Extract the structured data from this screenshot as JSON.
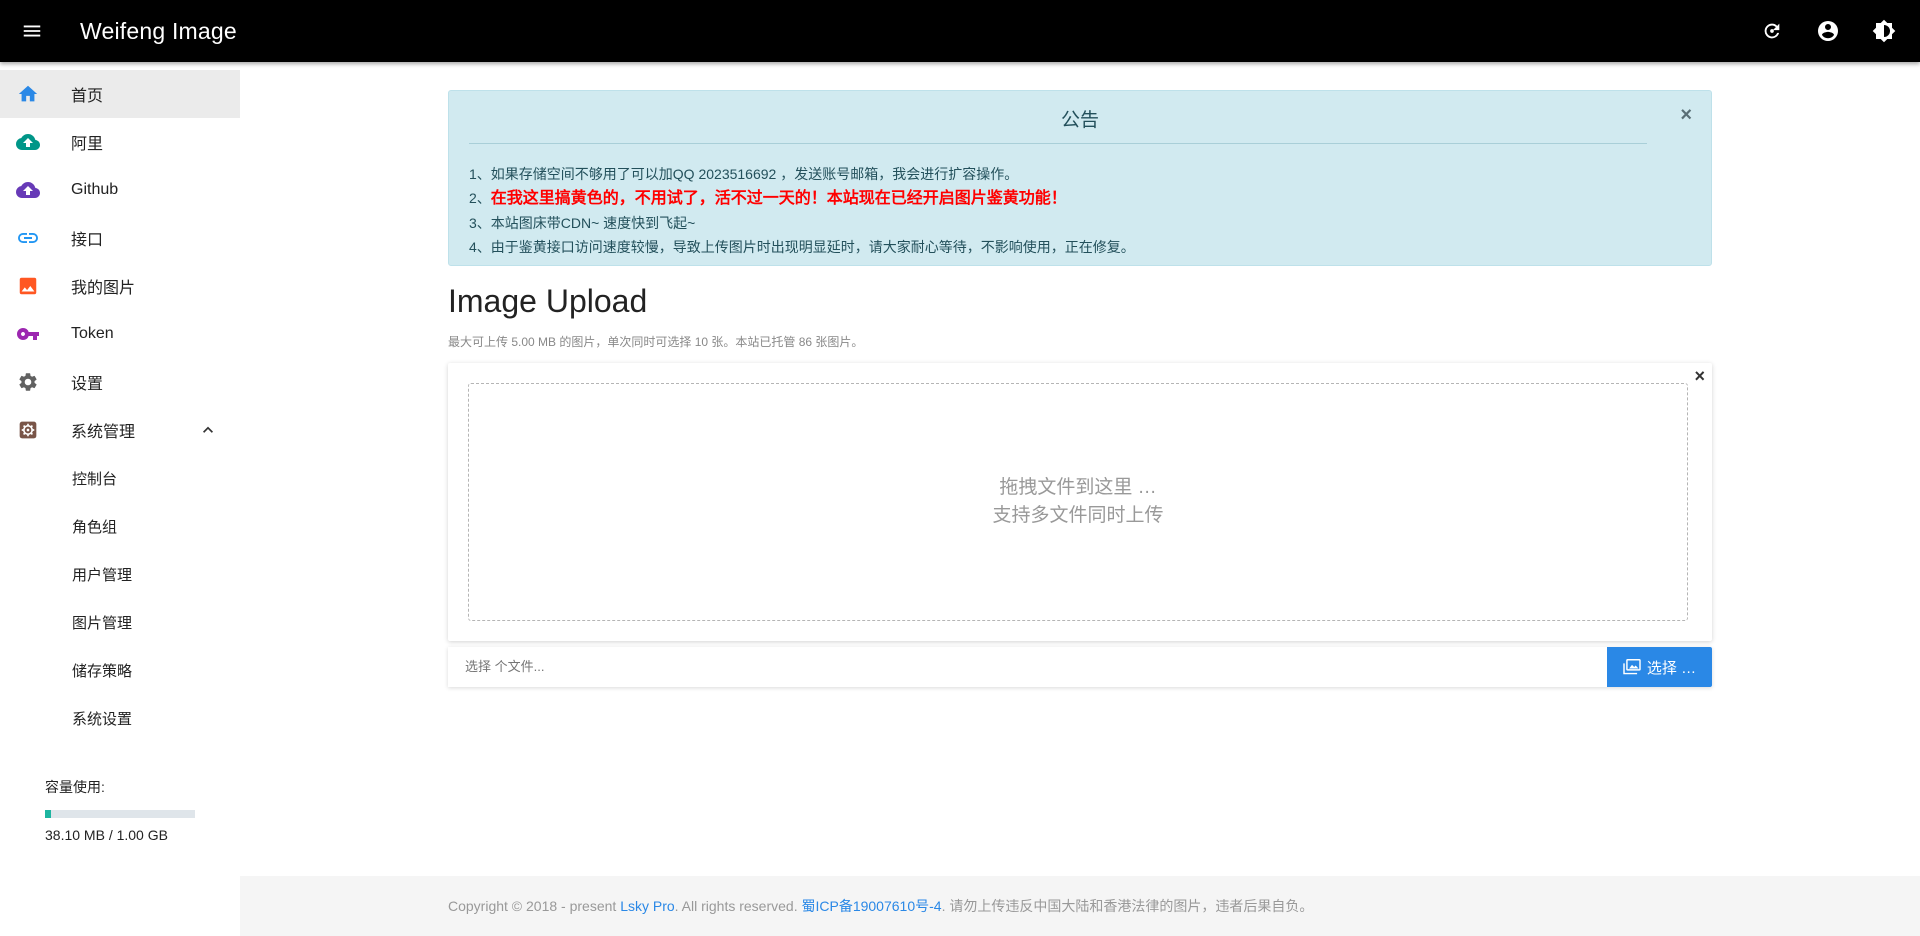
{
  "app": {
    "title": "Weifeng Image"
  },
  "topbar": {
    "menu_icon": "menu-icon",
    "actions": [
      "refresh-icon",
      "account-icon",
      "theme-icon"
    ]
  },
  "sidebar": {
    "items": [
      {
        "label": "首页",
        "icon": "home-icon",
        "color": "#2a88e6",
        "active": true
      },
      {
        "label": "阿里",
        "icon": "cloud-upload-icon",
        "color": "#009688"
      },
      {
        "label": "Github",
        "icon": "cloud-upload-icon",
        "color": "#673ab7"
      },
      {
        "label": "接口",
        "icon": "link-icon",
        "color": "#2196f3"
      },
      {
        "label": "我的图片",
        "icon": "image-icon",
        "color": "#ff5722"
      },
      {
        "label": "Token",
        "icon": "key-icon",
        "color": "#9c27b0"
      },
      {
        "label": "设置",
        "icon": "gear-icon",
        "color": "#616161"
      },
      {
        "label": "系统管理",
        "icon": "admin-gear-icon",
        "color": "#795548"
      }
    ],
    "sub_items": [
      "控制台",
      "角色组",
      "用户管理",
      "图片管理",
      "储存策略",
      "系统设置"
    ],
    "usage": {
      "title": "容量使用:",
      "value": "38.10 MB / 1.00 GB",
      "fraction": 0.0372
    }
  },
  "notice": {
    "title": "公告",
    "line1": "1、如果存储空间不够用了可以加QQ 2023516692 ，发送账号邮箱，我会进行扩容操作。",
    "line2_prefix": "2、",
    "line2_red": "在我这里搞黄色的，不用试了，活不过一天的！本站现在已经开启图片鉴黄功能！",
    "line3": "3、本站图床带CDN~ 速度快到飞起~",
    "line4": "4、由于鉴黄接口访问速度较慢，导致上传图片时出现明显延时，请大家耐心等待，不影响使用，正在修复。",
    "close": "×"
  },
  "upload": {
    "title": "Image Upload",
    "subtitle": "最大可上传 5.00 MB 的图片，单次同时可选择 10 张。本站已托管 86 张图片。",
    "drop_line1": "拖拽文件到这里 …",
    "drop_line2": "支持多文件同时上传",
    "close": "×",
    "caption_placeholder": "选择 个文件...",
    "choose_label": "选择 …"
  },
  "footer": {
    "prefix": "Copyright © 2018 - present ",
    "link1": "Lsky Pro",
    "middle": ". All rights reserved. ",
    "link2": "蜀ICP备19007610号-4",
    "suffix": ". 请勿上传违反中国大陆和香港法律的图片，违者后果自负。"
  }
}
